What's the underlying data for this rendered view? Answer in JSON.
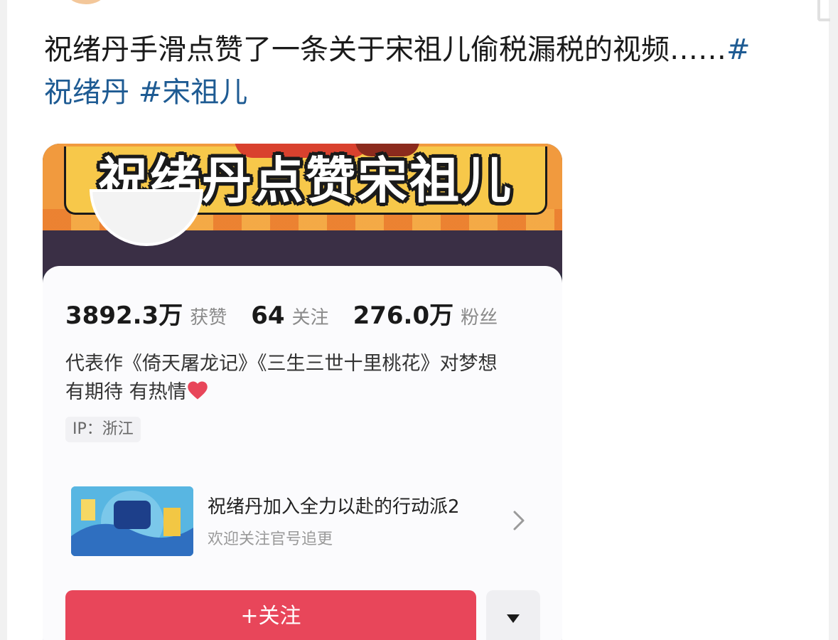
{
  "post": {
    "text": "祝绪丹手滑点赞了一条关于宋祖儿偷税漏税的视频……",
    "topics": [
      "#祝绪丹",
      "#宋祖儿"
    ]
  },
  "card": {
    "banner_title": "祝绪丹点赞宋祖儿",
    "stats": [
      {
        "value": "3892.3万",
        "label": "获赞"
      },
      {
        "value": "64",
        "label": "关注"
      },
      {
        "value": "276.0万",
        "label": "粉丝"
      }
    ],
    "bio_line1": "代表作《倚天屠龙记》《三生三世十里桃花》对梦想",
    "bio_line2": "有期待 有热情",
    "ip": "IP：浙江",
    "promo": {
      "title": "祝绪丹加入全力以赴的行动派2",
      "subtitle": "欢迎关注官号追更"
    },
    "follow_label": "+关注"
  },
  "colors": {
    "topic": "#1e5b93",
    "follow_button": "#e8465a",
    "banner": "#f19a3e",
    "heart": "#e8465a"
  },
  "icons": {
    "heart": "heart-icon",
    "chevron": "chevron-right-icon",
    "dropdown": "caret-down-icon"
  }
}
